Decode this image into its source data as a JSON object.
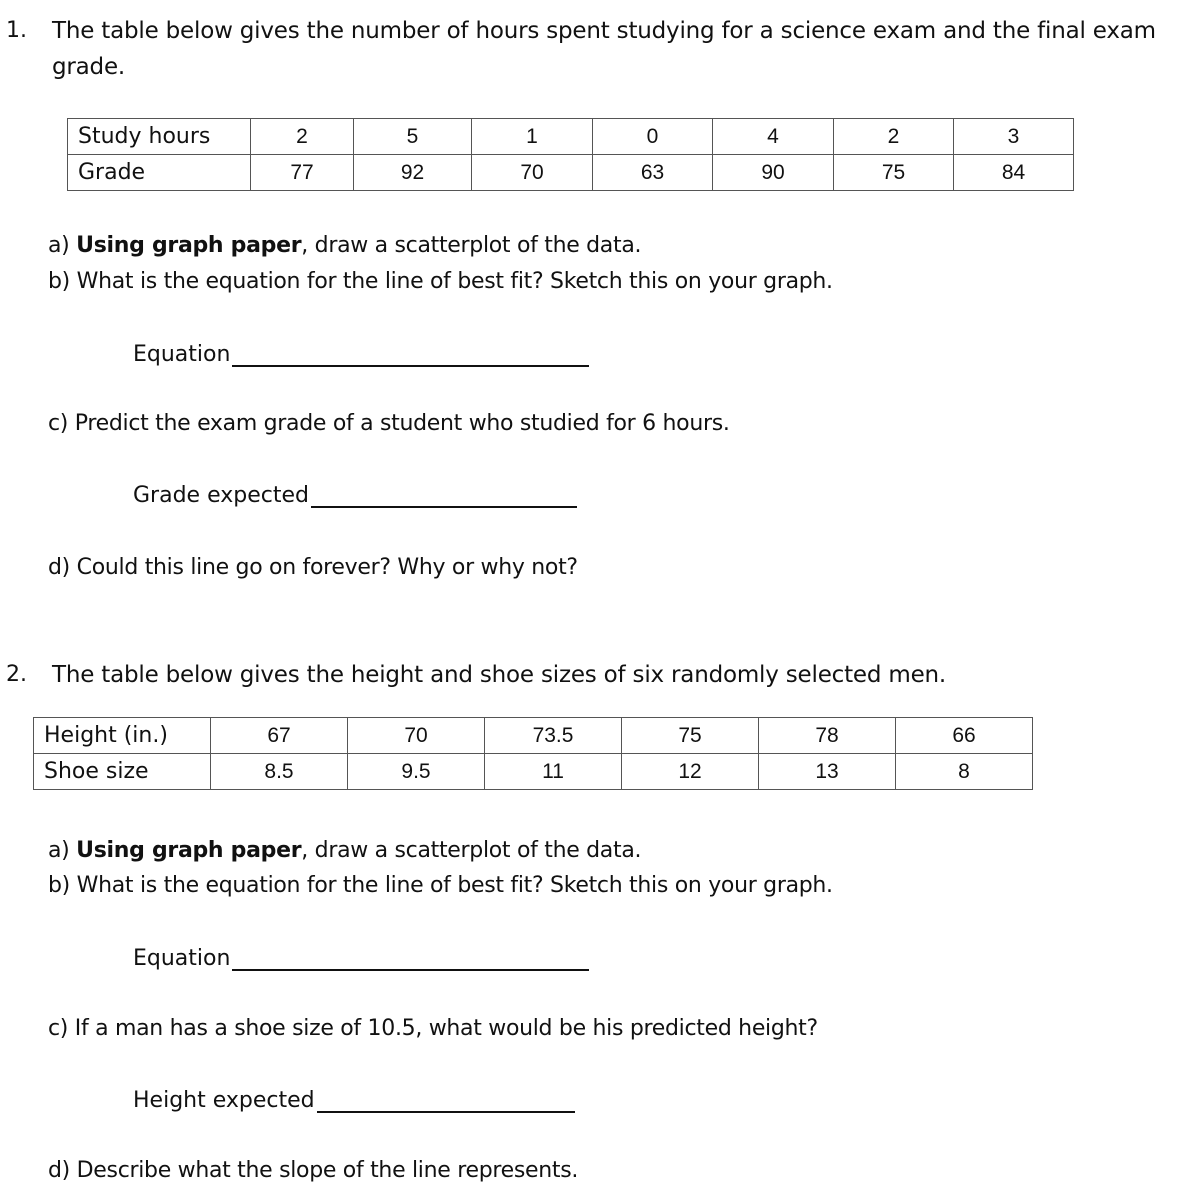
{
  "problem1": {
    "number": "1.",
    "intro_line1": "The table below gives the number of hours spent studying for a science exam and the final exam",
    "intro_line2": "grade.",
    "table": {
      "row_labels": [
        "Study hours",
        "Grade"
      ],
      "study_hours": [
        "2",
        "5",
        "1",
        "0",
        "4",
        "2",
        "3"
      ],
      "grade": [
        "77",
        "92",
        "70",
        "63",
        "90",
        "75",
        "84"
      ]
    },
    "part_a": {
      "marker": "a)",
      "bold": "Using graph paper",
      "rest": ", draw a scatterplot of the data."
    },
    "part_b": {
      "marker": "b)",
      "text": "What is the equation for the line of best fit?  Sketch this on your graph."
    },
    "equation_label": "Equation",
    "part_c": {
      "marker": "c)",
      "text": "Predict the exam grade of a student who studied for 6 hours."
    },
    "grade_expected_label": "Grade expected",
    "part_d": {
      "marker": "d)",
      "text": "Could this line go on forever?  Why or why not?"
    }
  },
  "problem2": {
    "number": "2.",
    "intro": "The table below gives the height and shoe sizes of six randomly selected men.",
    "table": {
      "row_labels": [
        "Height (in.)",
        "Shoe size"
      ],
      "height": [
        "67",
        "70",
        "73.5",
        "75",
        "78",
        "66"
      ],
      "shoe_size": [
        "8.5",
        "9.5",
        "11",
        "12",
        "13",
        "8"
      ]
    },
    "part_a": {
      "marker": "a)",
      "bold": "Using graph paper",
      "rest": ", draw a scatterplot of the data."
    },
    "part_b": {
      "marker": "b)",
      "text": "What is the equation for the line of best fit?  Sketch this on your graph."
    },
    "equation_label": "Equation",
    "part_c": {
      "marker": "c)",
      "text": "If a man has a shoe size of 10.5, what would be his predicted height?"
    },
    "height_expected_label": "Height expected",
    "part_d": {
      "marker": "d)",
      "text": "Describe what the slope of the line represents."
    }
  }
}
